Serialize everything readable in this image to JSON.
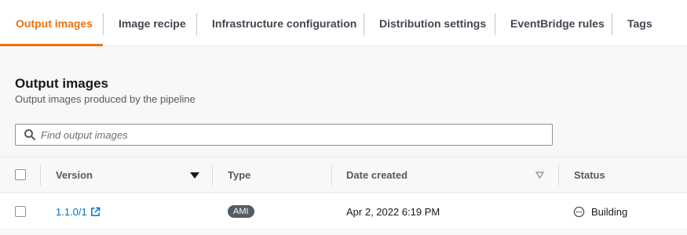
{
  "tabs": [
    {
      "label": "Output images",
      "active": true
    },
    {
      "label": "Image recipe"
    },
    {
      "label": "Infrastructure configuration"
    },
    {
      "label": "Distribution settings"
    },
    {
      "label": "EventBridge rules"
    },
    {
      "label": "Tags"
    }
  ],
  "section": {
    "title": "Output images",
    "subtitle": "Output images produced by the pipeline"
  },
  "search": {
    "placeholder": "Find output images",
    "value": ""
  },
  "table": {
    "columns": [
      "Version",
      "Type",
      "Date created",
      "Status"
    ],
    "sort": {
      "column": "Version",
      "direction": "descending"
    },
    "rows": [
      {
        "version": "1.1.0/1",
        "type": "AMI",
        "date_created": "Apr 2, 2022 6:19 PM",
        "status": "Building"
      }
    ]
  },
  "colors": {
    "accent": "#ec7211",
    "link": "#0073bb",
    "badge": "#545b64"
  },
  "icons": [
    "search-icon",
    "external-link-icon",
    "sort-desc-icon",
    "sort-icon",
    "status-in-progress-icon"
  ]
}
